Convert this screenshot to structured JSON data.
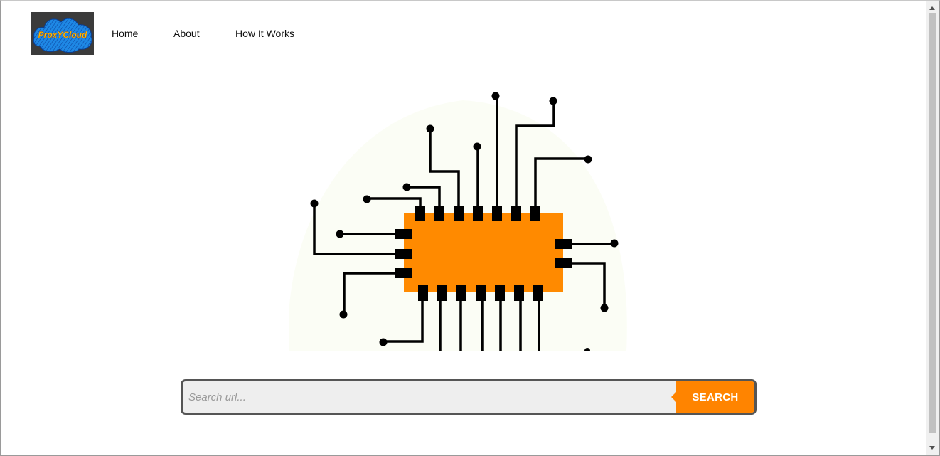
{
  "brand": {
    "logo_text": "ProxYCloud"
  },
  "nav": {
    "items": [
      {
        "label": "Home"
      },
      {
        "label": "About"
      },
      {
        "label": "How It Works"
      }
    ]
  },
  "hero": {
    "icon": "circuit-chip-illustration",
    "colors": {
      "chip": "#ff8a00",
      "traces": "#000000",
      "background_blob": "#fbfdf5"
    }
  },
  "search": {
    "placeholder": "Search url...",
    "value": "",
    "button_label": "SEARCH",
    "accent_color": "#ff8400"
  }
}
